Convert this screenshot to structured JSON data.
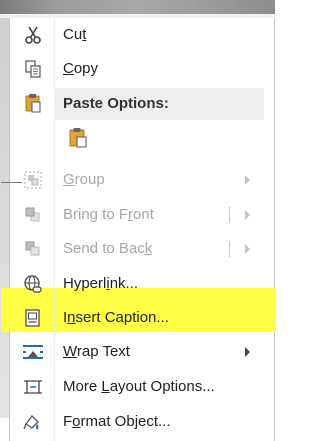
{
  "menu": {
    "cut": {
      "label_pre": "Cu",
      "label_u": "t",
      "label_post": ""
    },
    "copy": {
      "label_pre": "",
      "label_u": "C",
      "label_post": "opy"
    },
    "paste_options": {
      "label": "Paste Options:"
    },
    "group": {
      "label_pre": "",
      "label_u": "G",
      "label_post": "roup"
    },
    "bring_to_front": {
      "label_pre": "Bring to F",
      "label_u": "r",
      "label_post": "ont"
    },
    "send_to_back": {
      "label_pre": "Send to Bac",
      "label_u": "k",
      "label_post": ""
    },
    "hyperlink": {
      "label_pre": "Hyperl",
      "label_u": "i",
      "label_post": "nk..."
    },
    "insert_caption": {
      "label_pre": "I",
      "label_u": "n",
      "label_post": "sert Caption..."
    },
    "wrap_text": {
      "label_pre": "",
      "label_u": "W",
      "label_post": "rap Text"
    },
    "more_layout": {
      "label_pre": "More ",
      "label_u": "L",
      "label_post": "ayout Options..."
    },
    "format_object": {
      "label_pre": "F",
      "label_u": "o",
      "label_post": "rmat Object..."
    }
  },
  "colors": {
    "highlight": "#ffff45",
    "disabled_text": "#a7a7a7",
    "paste_icon": "#e0a43a"
  }
}
